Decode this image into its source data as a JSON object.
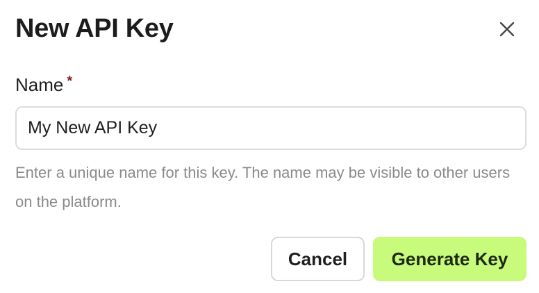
{
  "dialog": {
    "title": "New API Key",
    "close_icon": "close-icon"
  },
  "form": {
    "name_label": "Name",
    "required_mark": "*",
    "name_value": "My New API Key",
    "help_text": "Enter a unique name for this key. The name may be visible to other users on the platform."
  },
  "actions": {
    "cancel_label": "Cancel",
    "generate_label": "Generate Key"
  },
  "colors": {
    "primary_button": "#c8fa7c",
    "required_mark": "#8b2222",
    "help_text": "#8a8a8a"
  }
}
